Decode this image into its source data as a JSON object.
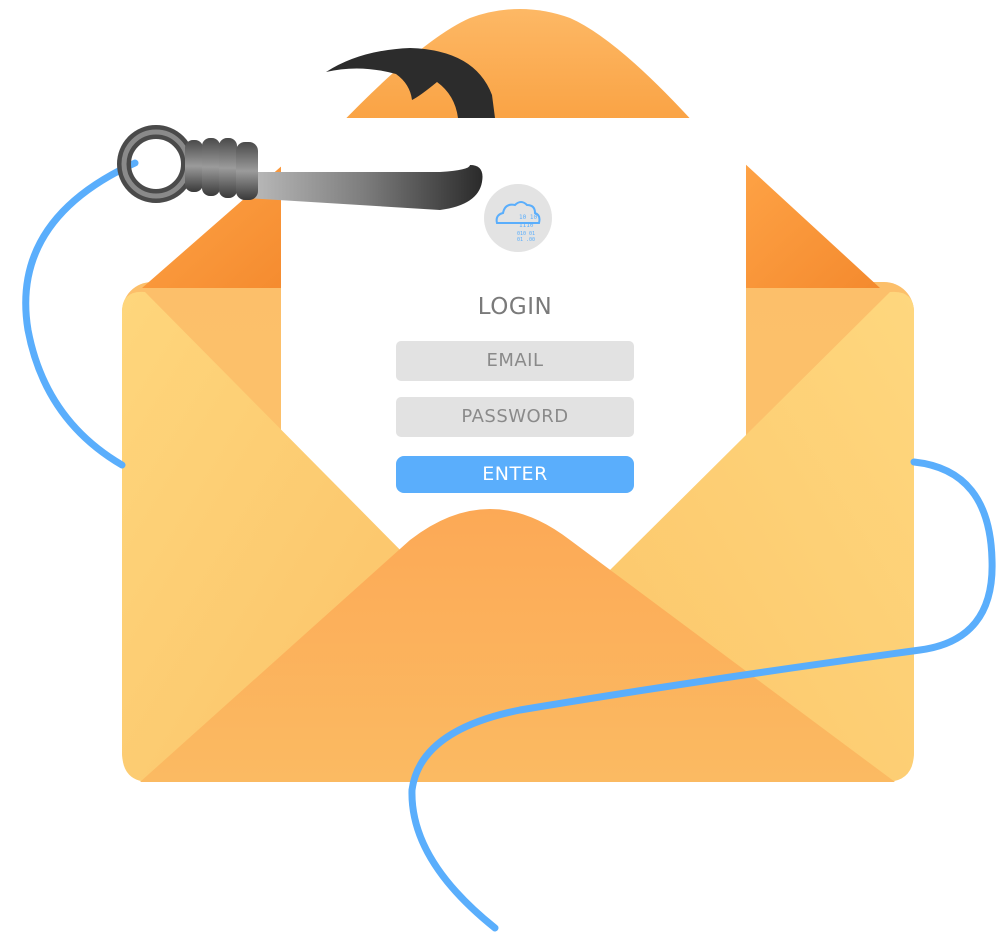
{
  "login": {
    "title": "LOGIN",
    "email_placeholder": "EMAIL",
    "password_placeholder": "PASSWORD",
    "enter_label": "ENTER"
  },
  "logo": {
    "icon": "cloud-binary-icon",
    "digits": [
      "10 10",
      "1110",
      "010 01",
      "01 .00"
    ]
  },
  "colors": {
    "envelope_light": "#fdd37a",
    "envelope_mid": "#fbb25c",
    "envelope_dark": "#f7913a",
    "fishing_line": "#5aaefc",
    "hook_dark": "#2c2c2c",
    "hook_light": "#9a9a9a",
    "card_white": "#ffffff",
    "field_grey": "#e2e2e2",
    "button_blue": "#5aaefc"
  },
  "icons": [
    "envelope-icon",
    "fishing-hook-icon",
    "fishing-line-icon",
    "cloud-binary-icon"
  ]
}
